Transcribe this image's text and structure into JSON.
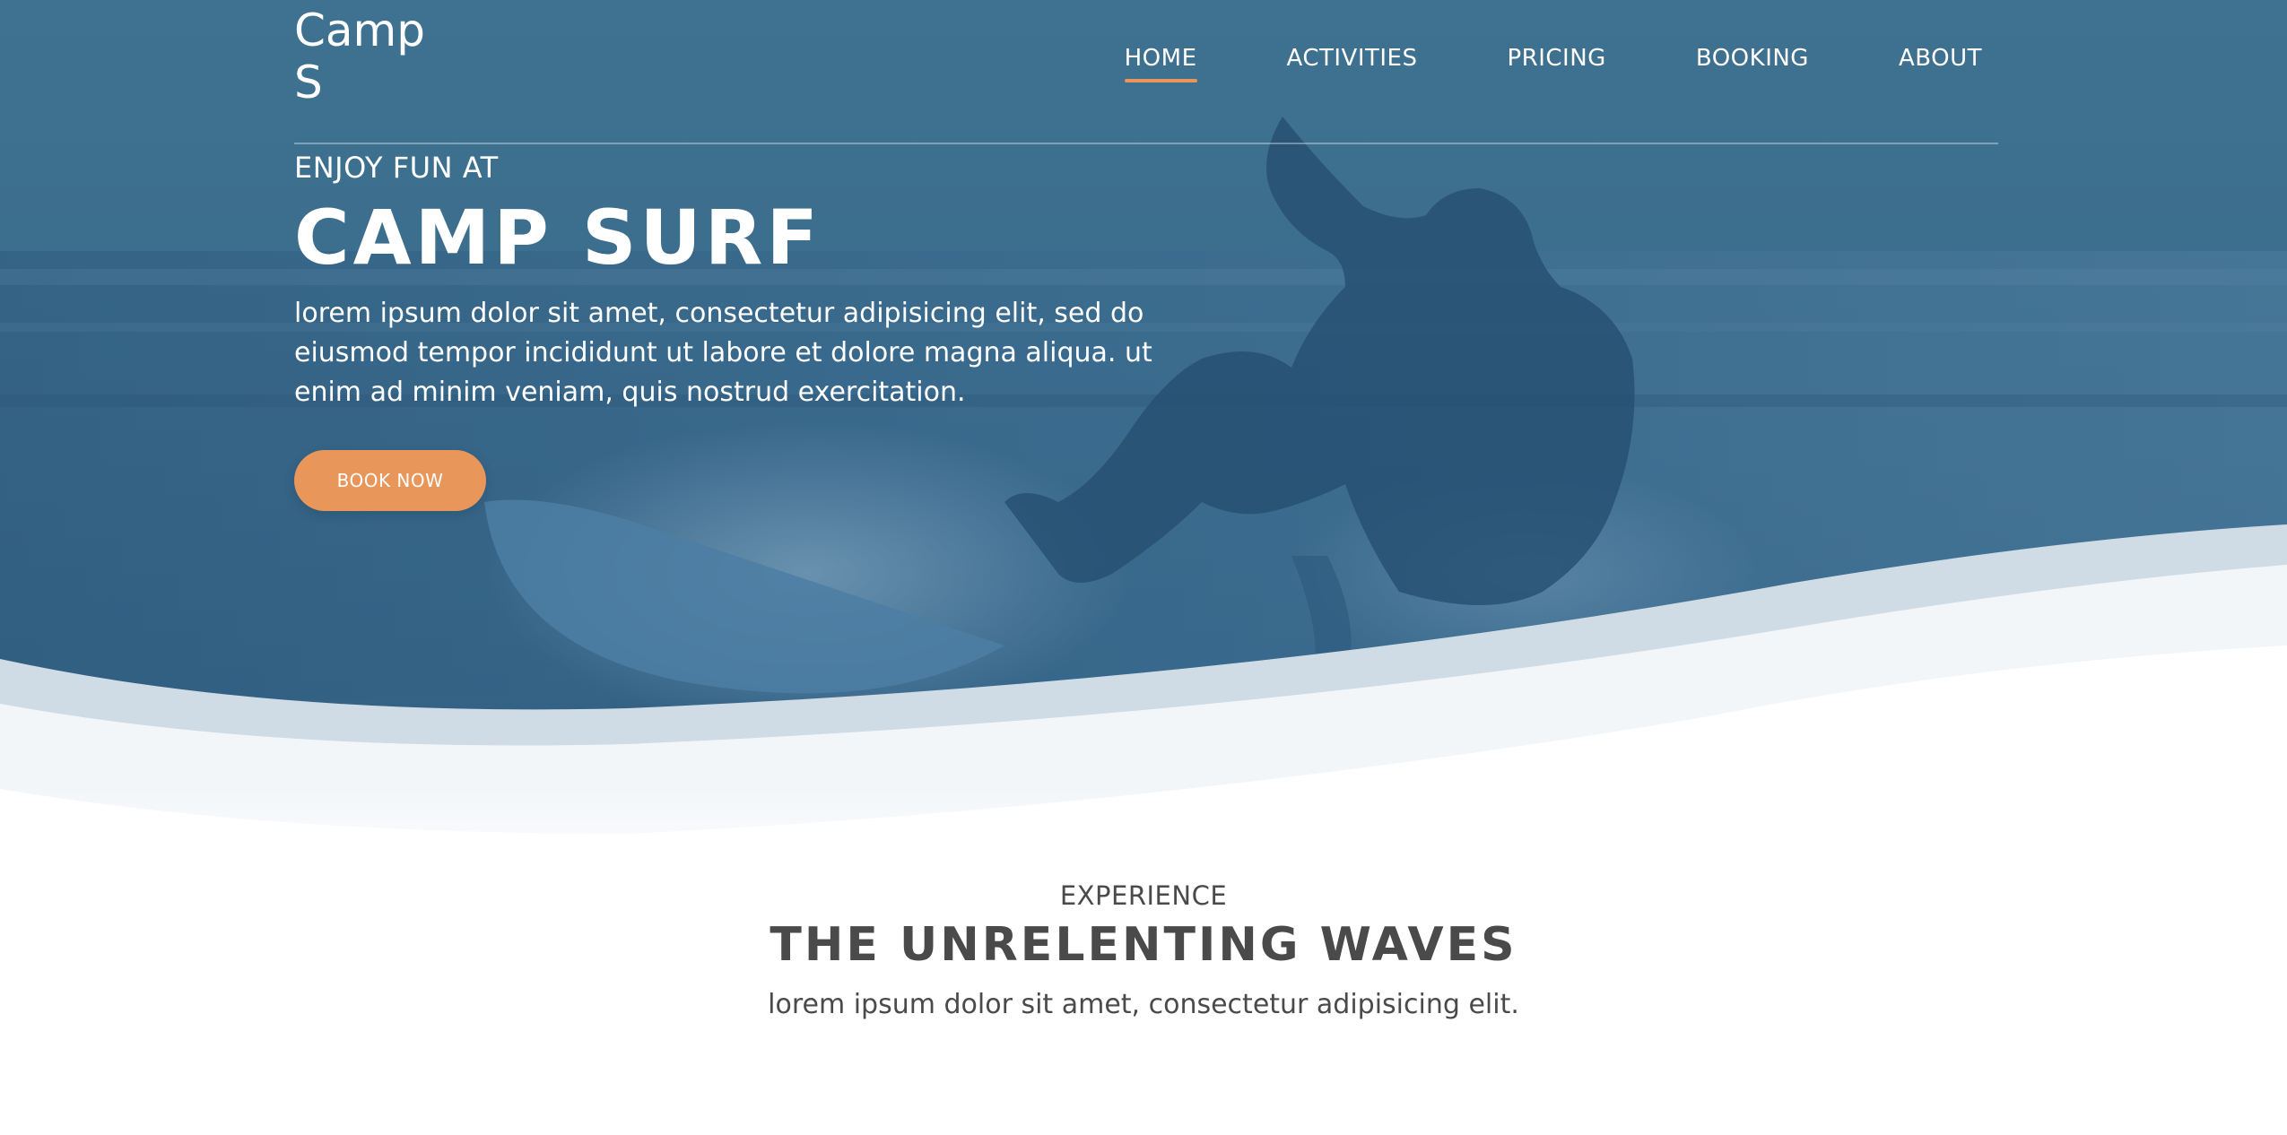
{
  "brand": {
    "logo_text": "Camp\nS"
  },
  "nav": {
    "items": [
      {
        "label": "HOME",
        "active": true
      },
      {
        "label": "ACTIVITIES",
        "active": false
      },
      {
        "label": "PRICING",
        "active": false
      },
      {
        "label": "BOOKING",
        "active": false
      },
      {
        "label": "ABOUT",
        "active": false
      }
    ]
  },
  "hero": {
    "eyebrow": "ENJOY FUN AT",
    "title": "CAMP SURF",
    "description": "lorem ipsum dolor sit amet, consectetur adipisicing elit, sed do eiusmod tempor incididunt ut labore et dolore magna aliqua. ut enim ad minim veniam, quis nostrud exercitation.",
    "cta_label": "BOOK NOW"
  },
  "section": {
    "eyebrow": "EXPERIENCE",
    "title": "THE UNRELENTING WAVES",
    "description": "lorem ipsum dolor sit amet, consectetur adipisicing elit."
  },
  "colors": {
    "hero_overlay": "#3e6f91",
    "accent": "#e8965a",
    "text_dark": "#4a4a4a",
    "wave_light": "#d3dee7"
  }
}
